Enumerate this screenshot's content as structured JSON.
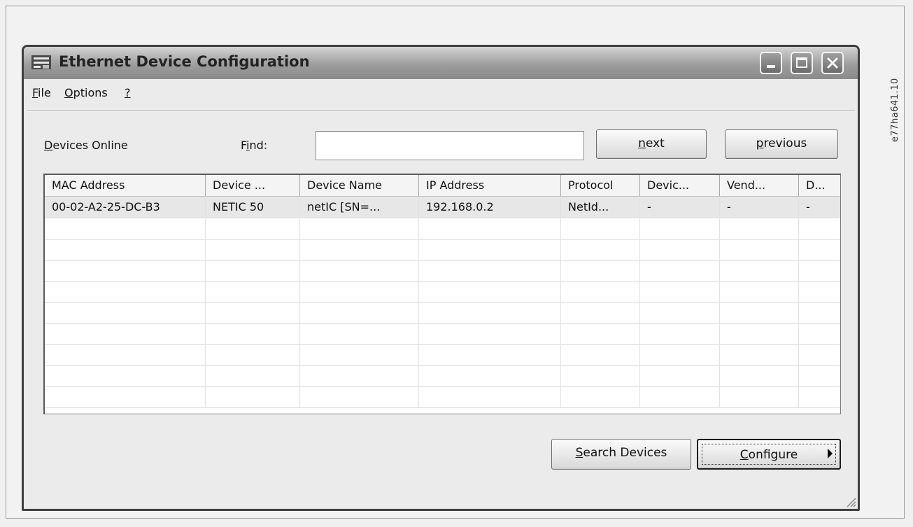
{
  "side_code": "e77ha641.10",
  "window": {
    "title": "Ethernet Device Configuration",
    "icon": "network-device-icon",
    "controls": [
      "minimize",
      "maximize",
      "close"
    ]
  },
  "menu": [
    {
      "label_hot": "F",
      "label_rest": "ile"
    },
    {
      "label_hot": "O",
      "label_rest": "ptions"
    },
    {
      "label_hot": "?",
      "label_rest": ""
    }
  ],
  "toolbar": {
    "devices_online_hot": "D",
    "devices_online_rest": "evices Online",
    "find_pre": "F",
    "find_hot": "i",
    "find_rest": "nd:",
    "find_value": "",
    "next_hot": "n",
    "next_rest": "ext",
    "prev_hot": "p",
    "prev_rest": "revious"
  },
  "grid": {
    "columns": [
      "MAC Address",
      "Device ...",
      "Device Name",
      "IP Address",
      "Protocol",
      "Devic...",
      "Vend...",
      "D..."
    ],
    "rows": [
      [
        "00-02-A2-25-DC-B3",
        "NETIC 50",
        "netIC [SN=...",
        "192.168.0.2",
        "NetId...",
        "-",
        "-",
        "-"
      ]
    ],
    "empty_rows": 9
  },
  "buttons": {
    "search_hot": "S",
    "search_rest": "earch Devices",
    "configure_hot": "C",
    "configure_rest": "onfigure"
  }
}
